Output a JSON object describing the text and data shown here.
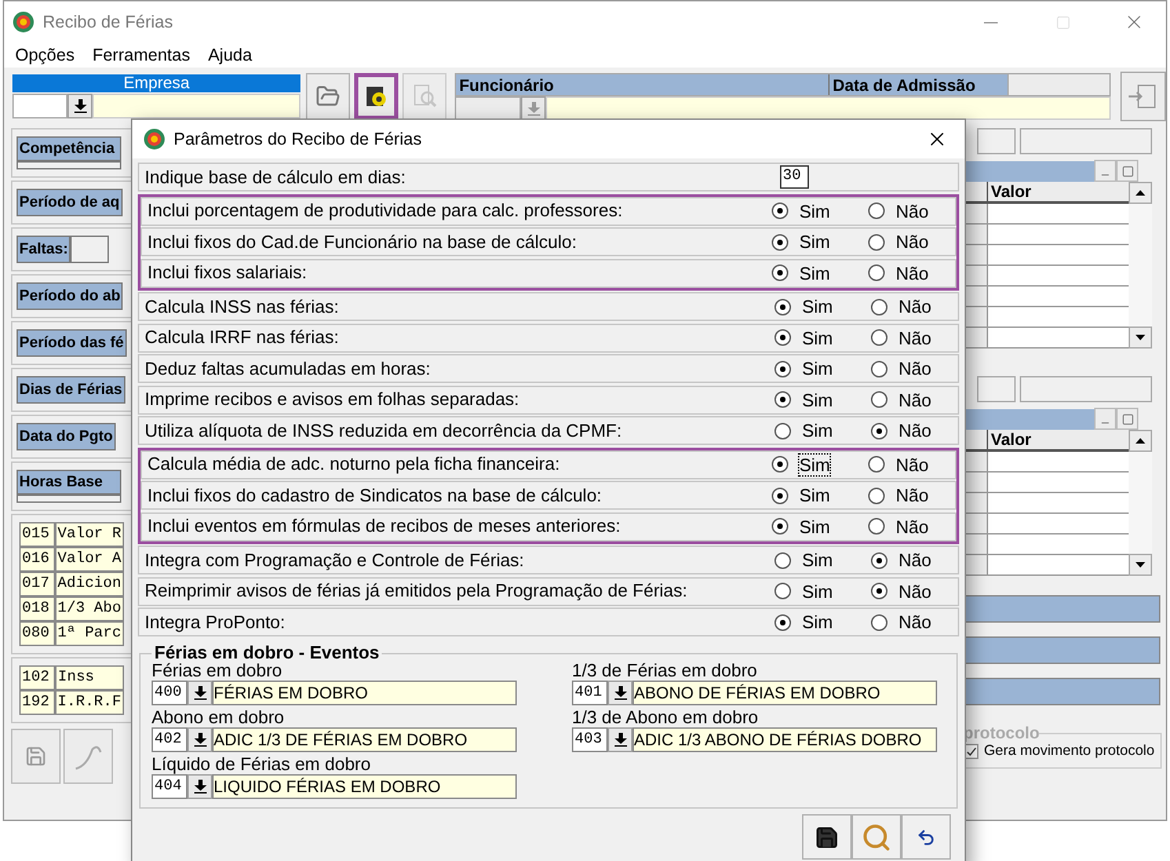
{
  "window": {
    "title": "Recibo de Férias"
  },
  "menu": [
    "Opções",
    "Ferramentas",
    "Ajuda"
  ],
  "toolbar": {
    "empresa_label": "Empresa",
    "headers": [
      "Funcionário",
      "Data de Admissão"
    ],
    "buttons": [
      {
        "kind": "folder",
        "highlighted": false,
        "disabled": false
      },
      {
        "kind": "params",
        "highlighted": true,
        "disabled": false
      },
      {
        "kind": "inspect",
        "highlighted": false,
        "disabled": true
      }
    ]
  },
  "left_panels": [
    {
      "kind": "stacked",
      "label": "Competência"
    },
    {
      "kind": "header",
      "label": "Período de aq"
    },
    {
      "kind": "field",
      "label": "Faltas:"
    },
    {
      "kind": "header",
      "label": "Período do ab"
    },
    {
      "kind": "header",
      "label": "Período das fé"
    },
    {
      "kind": "header",
      "label": "Dias de Férias"
    },
    {
      "kind": "header",
      "label": "Data do Pgto"
    },
    {
      "kind": "stacked",
      "label": "Horas Base"
    }
  ],
  "earnings": [
    {
      "code": "015",
      "name": "Valor R"
    },
    {
      "code": "016",
      "name": "Valor A"
    },
    {
      "code": "017",
      "name": "Adicion"
    },
    {
      "code": "018",
      "name": "1/3 Abo"
    },
    {
      "code": "080",
      "name": "1ª Parc"
    }
  ],
  "deductions": [
    {
      "code": "102",
      "name": "Inss"
    },
    {
      "code": "192",
      "name": "I.R.R.F"
    }
  ],
  "right_tables": [
    {
      "column": "Valor"
    },
    {
      "column": "Valor"
    }
  ],
  "protocolo": {
    "title": "protocolo",
    "checkbox": {
      "label": "Gera movimento protocolo",
      "checked": true
    }
  },
  "dialog": {
    "title": "Parâmetros do Recibo de Férias",
    "options": [
      {
        "kind": "number",
        "label": "Indique base de cálculo em dias:",
        "value": "30",
        "highlighted": false
      },
      {
        "kind": "radio",
        "label": "Inclui porcentagem de produtividade para calc. professores:",
        "highlighted": true,
        "choices": [
          {
            "label": "Sim",
            "selected": true,
            "focused": false
          },
          {
            "label": "Não",
            "selected": false,
            "focused": false
          }
        ]
      },
      {
        "kind": "radio",
        "label": "Inclui fixos do Cad.de Funcionário na base de cálculo:",
        "highlighted": true,
        "choices": [
          {
            "label": "Sim",
            "selected": true,
            "focused": false
          },
          {
            "label": "Não",
            "selected": false,
            "focused": false
          }
        ]
      },
      {
        "kind": "radio",
        "label": "Inclui fixos salariais:",
        "highlighted": true,
        "choices": [
          {
            "label": "Sim",
            "selected": true,
            "focused": false
          },
          {
            "label": "Não",
            "selected": false,
            "focused": false
          }
        ]
      },
      {
        "kind": "radio",
        "label": "Calcula INSS nas férias:",
        "highlighted": false,
        "choices": [
          {
            "label": "Sim",
            "selected": true,
            "focused": false
          },
          {
            "label": "Não",
            "selected": false,
            "focused": false
          }
        ]
      },
      {
        "kind": "radio",
        "label": "Calcula IRRF nas férias:",
        "highlighted": false,
        "choices": [
          {
            "label": "Sim",
            "selected": true,
            "focused": false
          },
          {
            "label": "Não",
            "selected": false,
            "focused": false
          }
        ]
      },
      {
        "kind": "radio",
        "label": "Deduz faltas acumuladas em horas:",
        "highlighted": false,
        "choices": [
          {
            "label": "Sim",
            "selected": true,
            "focused": false
          },
          {
            "label": "Não",
            "selected": false,
            "focused": false
          }
        ]
      },
      {
        "kind": "radio",
        "label": "Imprime recibos e avisos em folhas separadas:",
        "highlighted": false,
        "choices": [
          {
            "label": "Sim",
            "selected": true,
            "focused": false
          },
          {
            "label": "Não",
            "selected": false,
            "focused": false
          }
        ]
      },
      {
        "kind": "radio",
        "label": "Utiliza alíquota de INSS reduzida em decorrência da CPMF:",
        "highlighted": false,
        "choices": [
          {
            "label": "Sim",
            "selected": false,
            "focused": false
          },
          {
            "label": "Não",
            "selected": true,
            "focused": false
          }
        ]
      },
      {
        "kind": "radio",
        "label": "Calcula média de adc. noturno pela ficha financeira:",
        "highlighted": true,
        "choices": [
          {
            "label": "Sim",
            "selected": true,
            "focused": true
          },
          {
            "label": "Não",
            "selected": false,
            "focused": false
          }
        ]
      },
      {
        "kind": "radio",
        "label": "Inclui fixos do cadastro de Sindicatos na base de cálculo:",
        "highlighted": true,
        "choices": [
          {
            "label": "Sim",
            "selected": true,
            "focused": false
          },
          {
            "label": "Não",
            "selected": false,
            "focused": false
          }
        ]
      },
      {
        "kind": "radio",
        "label": "Inclui eventos em fórmulas de recibos de meses anteriores:",
        "highlighted": true,
        "choices": [
          {
            "label": "Sim",
            "selected": true,
            "focused": false
          },
          {
            "label": "Não",
            "selected": false,
            "focused": false
          }
        ]
      },
      {
        "kind": "radio",
        "label": "Integra com Programação e Controle de Férias:",
        "highlighted": false,
        "choices": [
          {
            "label": "Sim",
            "selected": false,
            "focused": false
          },
          {
            "label": "Não",
            "selected": true,
            "focused": false
          }
        ]
      },
      {
        "kind": "radio",
        "label": "Reimprimir avisos de férias já emitidos pela Programação de Férias:",
        "highlighted": false,
        "choices": [
          {
            "label": "Sim",
            "selected": false,
            "focused": false
          },
          {
            "label": "Não",
            "selected": true,
            "focused": false
          }
        ]
      },
      {
        "kind": "radio",
        "label": "Integra ProPonto:",
        "highlighted": false,
        "choices": [
          {
            "label": "Sim",
            "selected": true,
            "focused": false
          },
          {
            "label": "Não",
            "selected": false,
            "focused": false
          }
        ]
      }
    ],
    "events_group": {
      "title": "Férias em dobro - Eventos",
      "fields": [
        {
          "label": "Férias em dobro",
          "code": "400",
          "value": "FÉRIAS EM DOBRO"
        },
        {
          "label": "1/3 de Férias em dobro",
          "code": "401",
          "value": "ABONO DE FÉRIAS EM DOBRO"
        },
        {
          "label": "Abono em dobro",
          "code": "402",
          "value": "ADIC 1/3 DE FÉRIAS EM DOBRO"
        },
        {
          "label": "1/3 de Abono em dobro",
          "code": "403",
          "value": "ADIC 1/3 ABONO DE FÉRIAS DOBRO"
        },
        {
          "label": "Líquido de Férias em dobro",
          "code": "404",
          "value": "LIQUIDO FÉRIAS EM DOBRO"
        }
      ]
    },
    "buttons": [
      {
        "kind": "save"
      },
      {
        "kind": "search"
      },
      {
        "kind": "undo"
      }
    ]
  }
}
